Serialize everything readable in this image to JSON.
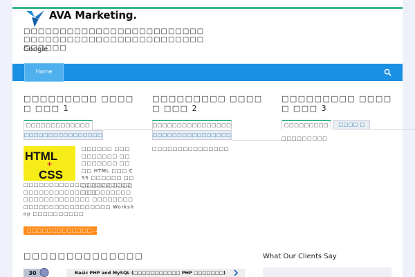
{
  "header": {
    "brand": "AVA Marketing.",
    "tagline": "□□□□□□□□□□□□□□□□□□□□□□□□□□□□□□□□□□□□□□□□□□□□□□□□□□□□□□□□",
    "tagline_2": "Google"
  },
  "nav": {
    "home_label": "Home",
    "search_icon": "search-icon"
  },
  "columns": [
    {
      "title": "□□□□□□□□□ □□□□□ □□□ 1",
      "tabs": [
        "□□□□□□□□□□□□□",
        "□□□□□□□□□□□□□□□□"
      ],
      "post_text": "□□□□□□ □□□□□□□□□□ □□□□□□□□□ □□□□ HTML □□□ CSS □□□□□□ □□□□□□□□□□□□□□□",
      "post_text_2": "□□□□□□□□□□□□□□□□□□□□□□□□□□□□□□□□□□□□□□□□□□□□□□□□□□□□□□□ □□□□□□□□□□□□□□□□□□□□□□□□□ Workshop □□□□□□□□□□",
      "thumb_text_1": "HTML",
      "thumb_text_2": "+",
      "thumb_text_3": "CSS",
      "read_more": "□□□□□□□□□□□□□..."
    },
    {
      "title": "□□□□□□□□□ □□□□□ □□□ 2",
      "tabs": [
        "□□□□□□□□□□□□□□□□",
        "□□□□□□□□□□□□□□□□□□"
      ],
      "line": "□□□□□□□□□□□□□□□"
    },
    {
      "title": "□□□□□□□□□ □□□□□ □□□ 3",
      "tabs": [
        "□□□□□□□□□",
        "□□□□ □"
      ],
      "line": "□□□□□□□□□"
    }
  ],
  "courses": {
    "section_title": "□□□□□□□□□□□□□□",
    "badge": "30",
    "row_label": "Basic PHP and MySQL (□□□□□□□□□□□ PHP □□□□□□□)"
  },
  "clients": {
    "title": "What Our Clients Say"
  },
  "colors": {
    "nav": "#1a8fe3",
    "accent": "#3bb58f",
    "button": "#ff8c1a"
  }
}
